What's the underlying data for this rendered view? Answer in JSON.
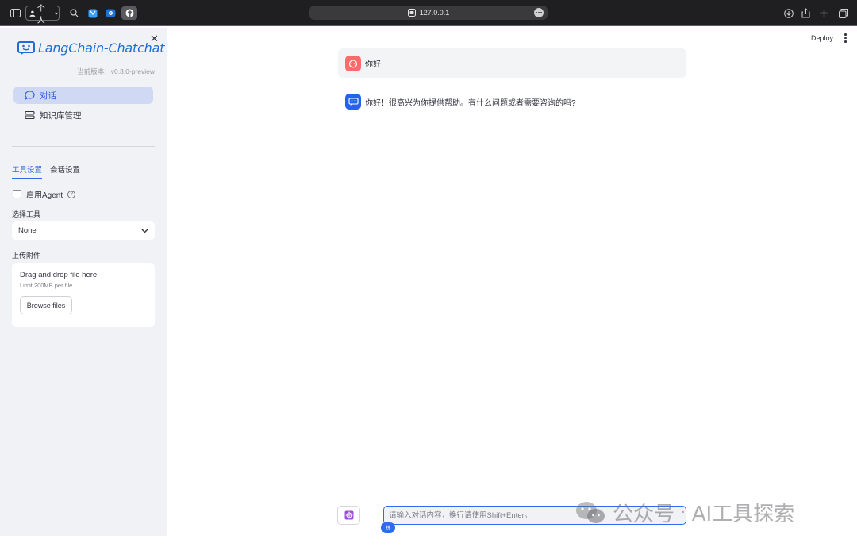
{
  "browser": {
    "profile_label": "个人",
    "url": "127.0.0.1"
  },
  "sidebar": {
    "logo_text": "LangChain-Chatchat",
    "version": "当前版本：v0.3.0-preview",
    "nav": [
      {
        "label": "对话",
        "icon": "chat-bubble-icon",
        "active": true
      },
      {
        "label": "知识库管理",
        "icon": "database-icon",
        "active": false
      }
    ],
    "tabs": [
      {
        "label": "工具设置",
        "active": true
      },
      {
        "label": "会话设置",
        "active": false
      }
    ],
    "agent_checkbox_label": "启用Agent",
    "tool_select_label": "选择工具",
    "tool_select_value": "None",
    "upload_label": "上传附件",
    "upload_title": "Drag and drop file here",
    "upload_limit": "Limit 200MB per file",
    "browse_label": "Browse files"
  },
  "header": {
    "deploy_label": "Deploy"
  },
  "messages": [
    {
      "role": "user",
      "text": "你好"
    },
    {
      "role": "assistant",
      "text": "你好！很高兴为你提供帮助。有什么问题或者需要咨询的吗?"
    }
  ],
  "input": {
    "placeholder": "请输入对话内容，换行请使用Shift+Enter。",
    "ime_badge": "拼"
  },
  "watermark": {
    "text_a": "公众号",
    "separator": "·",
    "text_b": "AI工具探索"
  },
  "colors": {
    "accent": "#2f6bea",
    "sidebar_bg": "#f0f2f6",
    "user_avatar": "#ff6b6b",
    "assistant_avatar": "#2563eb"
  }
}
